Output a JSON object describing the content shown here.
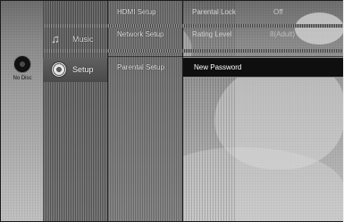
{
  "disc": {
    "label": "No Disc",
    "icon": "disc-icon"
  },
  "main_menu": [
    {
      "label": "Music",
      "icon": "music-note-icon",
      "selected": false
    },
    {
      "label": "Setup",
      "icon": "gear-icon",
      "selected": true
    }
  ],
  "setup_submenu": [
    {
      "label": "HDMI Setup"
    },
    {
      "label": "Network Setup"
    },
    {
      "label": "Parental Setup",
      "selected": true
    }
  ],
  "options": [
    {
      "label": "Parental Lock",
      "value": "Off"
    },
    {
      "label": "Rating Level",
      "value": "8(Adult)"
    },
    {
      "label": "New Password",
      "selected": true
    }
  ],
  "colors": {
    "highlight": "#0f0f0f",
    "selected_row": "#4a4a4a"
  }
}
